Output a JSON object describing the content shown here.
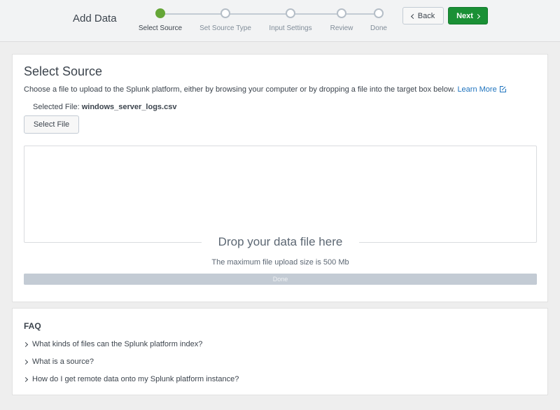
{
  "header": {
    "title": "Add Data",
    "steps": [
      {
        "label": "Select Source",
        "active": true
      },
      {
        "label": "Set Source Type",
        "active": false
      },
      {
        "label": "Input Settings",
        "active": false
      },
      {
        "label": "Review",
        "active": false
      },
      {
        "label": "Done",
        "active": false
      }
    ],
    "back_label": "Back",
    "next_label": "Next"
  },
  "main": {
    "heading": "Select Source",
    "description": "Choose a file to upload to the Splunk platform, either by browsing your computer or by dropping a file into the target box below.",
    "learn_more": "Learn More",
    "selected_file_label": "Selected File:",
    "selected_file_name": "windows_server_logs.csv",
    "select_file_button": "Select File",
    "drop_text": "Drop your data file here",
    "max_size_text": "The maximum file upload size is 500 Mb",
    "progress_label": "Done",
    "progress_fraction": 1.0
  },
  "faq": {
    "title": "FAQ",
    "items": [
      "What kinds of files can the Splunk platform index?",
      "What is a source?",
      "How do I get remote data onto my Splunk platform instance?"
    ]
  },
  "colors": {
    "accent_green": "#65a637",
    "next_button": "#1a9035",
    "link": "#1e73be"
  },
  "icons": [
    "chevron-left-icon",
    "chevron-right-icon",
    "external-link-icon"
  ]
}
